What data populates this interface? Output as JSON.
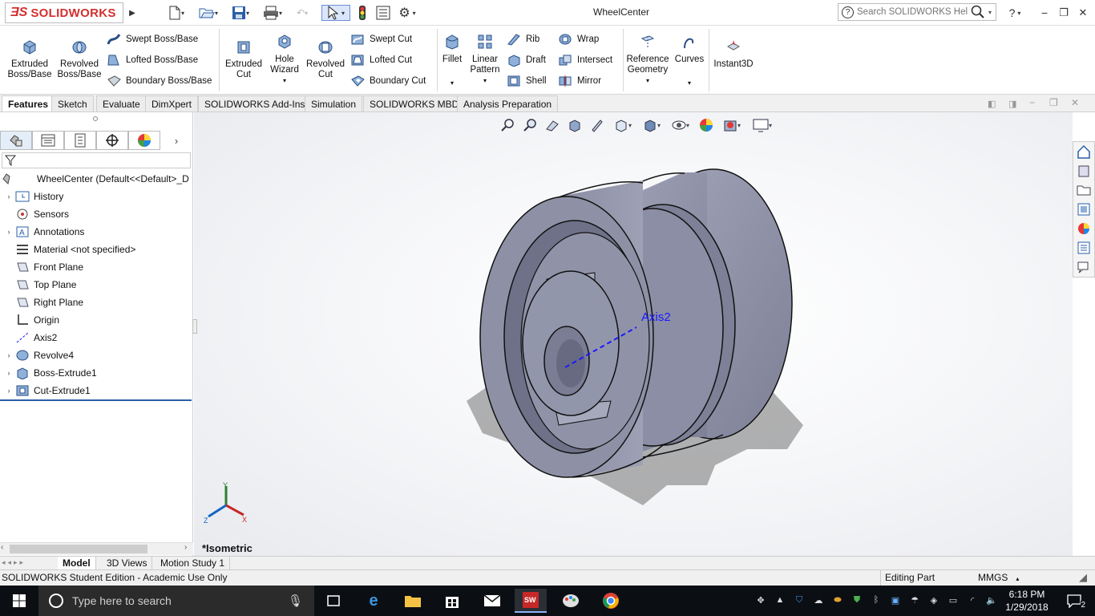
{
  "app": {
    "brand": "SOLIDWORKS",
    "window_title": "WheelCenter"
  },
  "help_search": {
    "placeholder": "Search SOLIDWORKS Help"
  },
  "titlebar_buttons": {
    "help": "?",
    "minimize": "−",
    "restore": "❐",
    "close": "✕"
  },
  "tools": {
    "extruded_boss": [
      "Extruded",
      "Boss/Base"
    ],
    "revolved_boss": [
      "Revolved",
      "Boss/Base"
    ],
    "swept_boss": "Swept Boss/Base",
    "lofted_boss": "Lofted Boss/Base",
    "boundary_boss": "Boundary Boss/Base",
    "extruded_cut": [
      "Extruded",
      "Cut"
    ],
    "hole_wizard": [
      "Hole",
      "Wizard"
    ],
    "revolved_cut": [
      "Revolved",
      "Cut"
    ],
    "swept_cut": "Swept Cut",
    "lofted_cut": "Lofted Cut",
    "boundary_cut": "Boundary Cut",
    "fillet": "Fillet",
    "linear_pattern": [
      "Linear",
      "Pattern"
    ],
    "rib": "Rib",
    "draft": "Draft",
    "shell": "Shell",
    "wrap": "Wrap",
    "intersect": "Intersect",
    "mirror": "Mirror",
    "reference_geometry": [
      "Reference",
      "Geometry"
    ],
    "curves": "Curves",
    "instant3d": "Instant3D"
  },
  "tabs": [
    "Features",
    "Sketch",
    "Evaluate",
    "DimXpert",
    "SOLIDWORKS Add-Ins",
    "Simulation",
    "SOLIDWORKS MBD",
    "Analysis Preparation"
  ],
  "active_tab": "Features",
  "tree": {
    "root": "WheelCenter  (Default<<Default>_D",
    "items": [
      {
        "label": "History",
        "expandable": true
      },
      {
        "label": "Sensors",
        "expandable": false
      },
      {
        "label": "Annotations",
        "expandable": true
      },
      {
        "label": "Material <not specified>",
        "expandable": false
      },
      {
        "label": "Front Plane",
        "expandable": false
      },
      {
        "label": "Top Plane",
        "expandable": false
      },
      {
        "label": "Right Plane",
        "expandable": false
      },
      {
        "label": "Origin",
        "expandable": false
      },
      {
        "label": "Axis2",
        "expandable": false
      },
      {
        "label": "Revolve4",
        "expandable": true
      },
      {
        "label": "Boss-Extrude1",
        "expandable": true
      },
      {
        "label": "Cut-Extrude1",
        "expandable": true
      }
    ]
  },
  "viewport": {
    "view_label": "*Isometric",
    "axis_label": "Axis2",
    "triad": {
      "x": "X",
      "y": "Y",
      "z": "Z"
    }
  },
  "bottom_tabs": [
    "Model",
    "3D Views",
    "Motion Study 1"
  ],
  "active_bottom_tab": "Model",
  "status": {
    "left": "SOLIDWORKS Student Edition - Academic Use Only",
    "mode": "Editing Part",
    "units": "MMGS"
  },
  "taskbar": {
    "search_placeholder": "Type here to search",
    "time": "6:18 PM",
    "date": "1/29/2018",
    "notifications": "2"
  },
  "colors": {
    "accent_red": "#d32f2f",
    "part_body": "#8e91a6",
    "axis": "#1a1aff"
  }
}
